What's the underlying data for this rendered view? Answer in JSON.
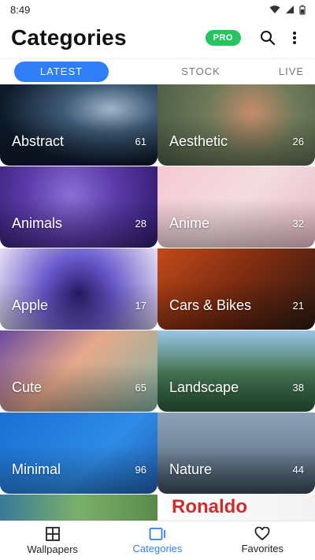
{
  "status": {
    "time": "8:49"
  },
  "app": {
    "title": "Categories",
    "pro_label": "PRO"
  },
  "tabs": [
    {
      "label": "LATEST",
      "active": true
    },
    {
      "label": "STOCK",
      "active": false
    },
    {
      "label": "LIVE",
      "active": false
    }
  ],
  "categories": [
    {
      "name": "Abstract",
      "count": "61"
    },
    {
      "name": "Aesthetic",
      "count": "26"
    },
    {
      "name": "Animals",
      "count": "28"
    },
    {
      "name": "Anime",
      "count": "32"
    },
    {
      "name": "Apple",
      "count": "17"
    },
    {
      "name": "Cars & Bikes",
      "count": "21"
    },
    {
      "name": "Cute",
      "count": "65"
    },
    {
      "name": "Landscape",
      "count": "38"
    },
    {
      "name": "Minimal",
      "count": "96"
    },
    {
      "name": "Nature",
      "count": "44"
    }
  ],
  "partial_tiles": {
    "right_text": "Ronaldo"
  },
  "bottom_nav": [
    {
      "label": "Wallpapers",
      "active": false,
      "icon": "grid-icon"
    },
    {
      "label": "Categories",
      "active": true,
      "icon": "categories-icon"
    },
    {
      "label": "Favorites",
      "active": false,
      "icon": "heart-icon"
    }
  ],
  "colors": {
    "accent": "#2f7ef7",
    "pro": "#22c55e"
  }
}
